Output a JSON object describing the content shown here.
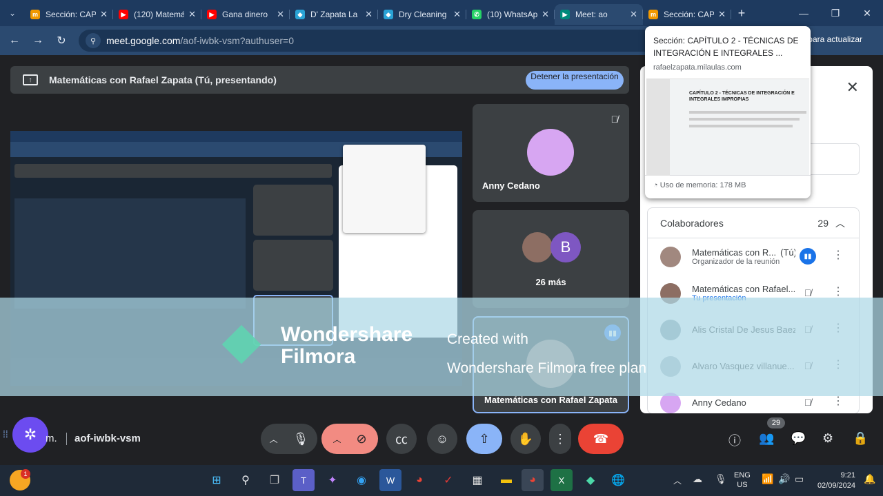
{
  "browser": {
    "tabs": [
      {
        "label": "Sección: CAPÍ",
        "icon_color": "#f29900",
        "icon_text": "m"
      },
      {
        "label": "(120) Matemá",
        "icon_color": "#ff0000",
        "icon_text": "▶"
      },
      {
        "label": "Gana dinero",
        "icon_color": "#ff0000",
        "icon_text": "▶"
      },
      {
        "label": "D' Zapata La",
        "icon_color": "#29a3d6",
        "icon_text": "◆"
      },
      {
        "label": "Dry Cleaning",
        "icon_color": "#29a3d6",
        "icon_text": "◆"
      },
      {
        "label": "(10) WhatsAp",
        "icon_color": "#25d366",
        "icon_text": "✆"
      },
      {
        "label": "Meet: ao",
        "icon_color": "#00897b",
        "icon_text": "▶"
      },
      {
        "label": "Sección: CAP",
        "icon_color": "#f29900",
        "icon_text": "m"
      }
    ],
    "url_domain": "meet.google.com",
    "url_path": "/aof-iwbk-vsm?authuser=0",
    "update_text": "para actualizar"
  },
  "presenting": {
    "title": "Matemáticas con Rafael Zapata (Tú, presentando)",
    "stop_label": "Detener la presentación"
  },
  "tiles": {
    "anny": "Anny Cedano",
    "more_initial": "B",
    "more": "26 más",
    "self": "Matemáticas con Rafael Zapata"
  },
  "tooltip": {
    "title": "Sección: CAPÍTULO 2 - TÉCNICAS DE INTEGRACIÓN E INTEGRALES ...",
    "domain": "rafaelzapata.milaulas.com",
    "thumb_heading": "CAPÍTULO 2 - TÉCNICAS DE INTEGRACIÓN E INTEGRALES IMPROPIAS",
    "memory": "Uso de memoria: 178 MB"
  },
  "panel": {
    "collab_label": "Colaboradores",
    "collab_count": "29",
    "people": [
      {
        "name": "Matemáticas con R...",
        "tag": "(Tú)",
        "sub": "Organizador de la reunión",
        "mic": "active"
      },
      {
        "name": "Matemáticas con Rafael...",
        "tag": "",
        "sub": "Tu presentación",
        "mic": "off"
      },
      {
        "name": "Alis Cristal De Jesus Baez",
        "tag": "",
        "sub": "",
        "mic": "off"
      },
      {
        "name": "Alvaro Vasquez villanue...",
        "tag": "",
        "sub": "",
        "mic": "off"
      },
      {
        "name": "Anny Cedano",
        "tag": "",
        "sub": "",
        "mic": "off"
      }
    ]
  },
  "watermark": {
    "brand1": "Wondershare",
    "brand2": "Filmora",
    "line1": "Created with",
    "line2": "Wondershare Filmora free plan"
  },
  "meeting": {
    "name_short": "m.",
    "code": "aof-iwbk-vsm",
    "participants_badge": "29"
  },
  "taskbar": {
    "lang": "ENG",
    "region": "US",
    "time": "9:21",
    "date": "02/09/2024",
    "notif_badge": "1"
  }
}
